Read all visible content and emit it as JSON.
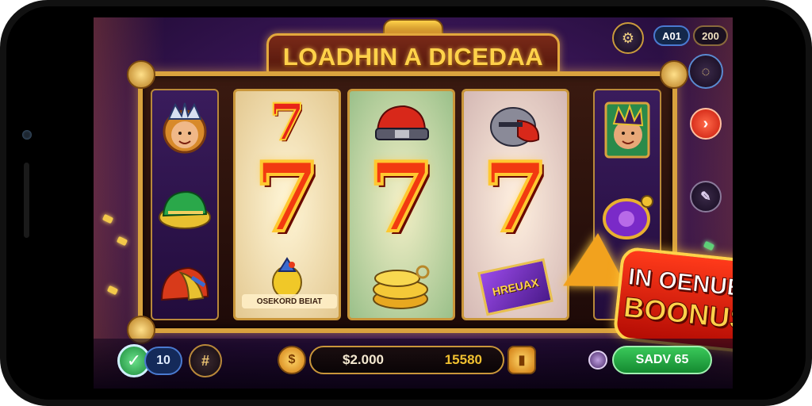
{
  "title": "LOADHIN A DICEDAA",
  "hud": {
    "top_left_badge": "A01",
    "top_right_value": "200"
  },
  "reels": {
    "seven": "7",
    "reel1_label": "OSEKORD BEIAT",
    "reel3_gem_label": "HREUAX"
  },
  "bonus": {
    "line1": "IN OENUER",
    "line2": "BOONUS!"
  },
  "bottom": {
    "lines_value": "10",
    "balance": "$2.000",
    "win": "15580",
    "spin_value": "SADV 65"
  },
  "icons": {
    "settings": "gear-icon",
    "menu": "circle-menu-icon",
    "next": "arrow-right-icon",
    "tool": "wrench-icon",
    "check": "checkmark-icon",
    "hash": "grid-icon"
  },
  "colors": {
    "accent_gold": "#d9a23e",
    "bonus_red": "#e8240c",
    "spin_green": "#2aa84a"
  }
}
